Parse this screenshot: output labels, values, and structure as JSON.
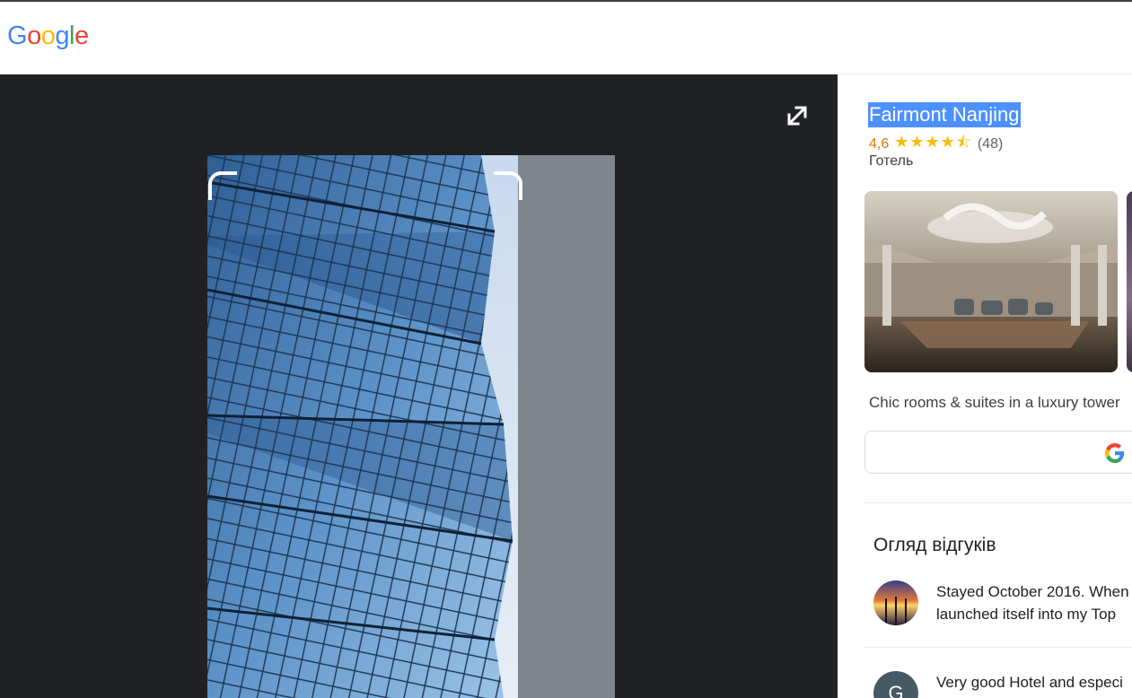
{
  "header": {
    "logo_letters": [
      {
        "ch": "G",
        "color": "#4285F4"
      },
      {
        "ch": "o",
        "color": "#EA4335"
      },
      {
        "ch": "o",
        "color": "#FBBC05"
      },
      {
        "ch": "g",
        "color": "#4285F4"
      },
      {
        "ch": "l",
        "color": "#34A853"
      },
      {
        "ch": "e",
        "color": "#EA4335"
      }
    ]
  },
  "viewer": {
    "expand_icon": "expand-diagonal-icon",
    "photo_subject": "glass-tower-facade"
  },
  "place": {
    "title": "Fairmont Nanjing",
    "rating": "4,6",
    "stars": "★★★★⯪",
    "stars_value": 4.6,
    "review_count": "(48)",
    "category": "Готель",
    "description": "Chic rooms & suites in a luxury tower",
    "search_icon": "google-g-icon"
  },
  "reviews": {
    "title": "Огляд відгуків",
    "items": [
      {
        "line1": "Stayed October 2016. When",
        "line2": "launched itself into my Top",
        "avatar": "sunset-photo-avatar"
      },
      {
        "line1": "Very good Hotel and especi",
        "avatar_letter": "G"
      }
    ]
  },
  "colors": {
    "viewer_bg": "#202124",
    "highlight": "#4d90fe",
    "star": "#fbbc04",
    "rating_text": "#e37400"
  }
}
